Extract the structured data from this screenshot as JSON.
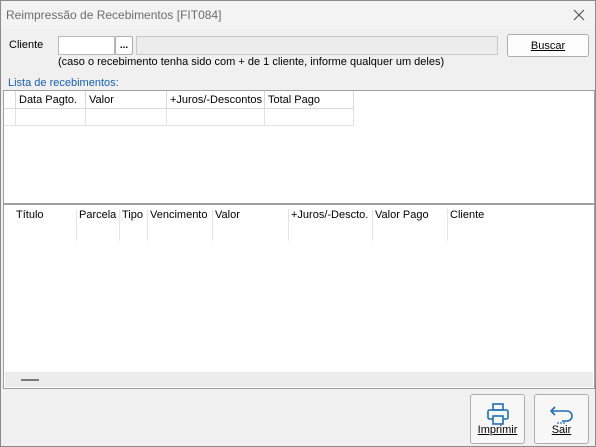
{
  "window": {
    "title": "Reimpressão de Recebimentos [FIT084]"
  },
  "cliente": {
    "label": "Cliente",
    "code_value": "",
    "lookup_label": "...",
    "name_value": "",
    "hint": "(caso o recebimento tenha sido com + de 1 cliente, informe qualquer um deles)"
  },
  "buttons": {
    "buscar": "Buscar",
    "imprimir": "Imprimir",
    "sair": "Sair"
  },
  "lista": {
    "title": "Lista de recebimentos:",
    "columns": [
      "Data Pagto.",
      "Valor",
      "+Juros/-Descontos",
      "Total Pago"
    ]
  },
  "detalhe": {
    "columns": [
      "Título",
      "Parcela",
      "Tipo",
      "Vencimento",
      "Valor",
      "+Juros/-Descto.",
      "Valor Pago",
      "Cliente"
    ]
  },
  "colors": {
    "section_title": "#1a5fb4",
    "border": "#a0a0a0"
  },
  "icons": {
    "close": "close-icon",
    "printer": "printer-icon",
    "exit": "return-arrow-icon"
  }
}
